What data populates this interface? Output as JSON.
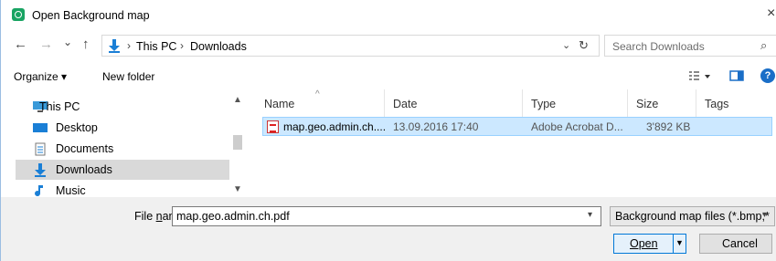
{
  "window": {
    "title": "Open Background map",
    "close": "×"
  },
  "nav": {
    "back": "←",
    "forward": "→",
    "recent": "⌄",
    "up": "↑"
  },
  "address": {
    "crumbs": [
      "This PC",
      "Downloads"
    ],
    "separator": "›",
    "dropdown": "⌄",
    "refresh": "↻"
  },
  "search": {
    "placeholder": "Search Downloads",
    "icon": "⌕"
  },
  "toolbar": {
    "organize": "Organize ▾",
    "new_folder": "New folder",
    "help": "?"
  },
  "tree": {
    "items": [
      {
        "label": "This PC",
        "icon": "computer-icon",
        "selected": false
      },
      {
        "label": "Desktop",
        "icon": "desktop-folder-icon",
        "selected": false
      },
      {
        "label": "Documents",
        "icon": "documents-icon",
        "selected": false
      },
      {
        "label": "Downloads",
        "icon": "download-icon",
        "selected": true
      },
      {
        "label": "Music",
        "icon": "music-icon",
        "selected": false
      }
    ]
  },
  "columns": [
    "Name",
    "Date",
    "Type",
    "Size",
    "Tags"
  ],
  "files": [
    {
      "name": "map.geo.admin.ch....",
      "date": "13.09.2016 17:40",
      "type": "Adobe Acrobat D...",
      "size": "3'892 KB",
      "icon": "pdf-icon"
    }
  ],
  "footer": {
    "file_name_label_pre": "File ",
    "file_name_label_u": "n",
    "file_name_label_post": "ame:",
    "file_name_value": "map.geo.admin.ch.pdf",
    "filter_value": "Background map files (*.bmp;*",
    "open_label": "Open",
    "cancel_label": "Cancel"
  },
  "colors": {
    "selection": "#cce8ff",
    "accent": "#0078d7",
    "tree_selection": "#d9d9d9"
  }
}
